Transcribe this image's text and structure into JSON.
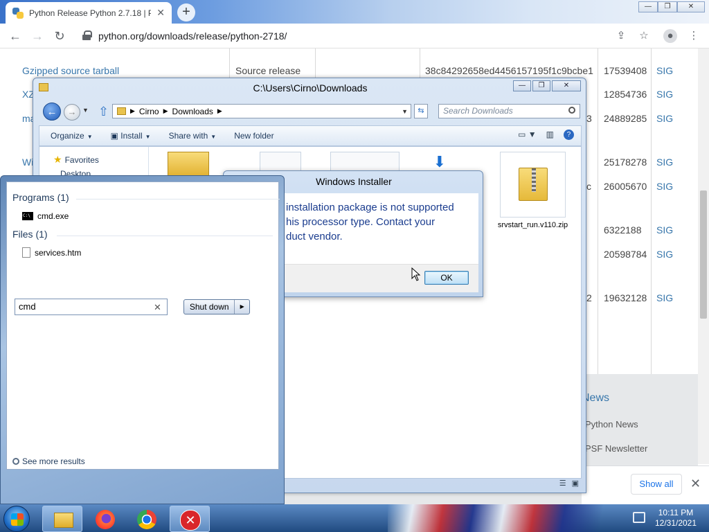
{
  "browser": {
    "tab_title": "Python Release Python 2.7.18 | P",
    "tab_close": "✕",
    "new_tab": "+",
    "url": "python.org/downloads/release/python-2718/",
    "window_controls": [
      "—",
      "❐",
      "✕"
    ]
  },
  "downloads_table": {
    "rows": [
      {
        "name": "Gzipped source tarball",
        "os": "Source release",
        "md5": "38c84292658ed4456157195f1c9bcbe1",
        "size": "17539408",
        "sig": "SIG"
      },
      {
        "name": "XZ",
        "size": "12854736",
        "sig": "SIG"
      },
      {
        "name": "ma",
        "md5_tail": "3",
        "size": "24889285",
        "sig": "SIG"
      },
      {
        "name": "Wi",
        "size": "25178278",
        "sig": "SIG"
      },
      {
        "md5_tail": "c",
        "size": "26005670",
        "sig": "SIG"
      },
      {
        "size": "6322188",
        "sig": "SIG"
      },
      {
        "size": "20598784",
        "sig": "SIG"
      },
      {
        "md5_tail": "2",
        "size": "19632128",
        "sig": "SIG"
      }
    ],
    "news_heading": "News",
    "news_items": [
      "Python News",
      "PSF Newsletter"
    ]
  },
  "download_bar": {
    "show_all": "Show all",
    "close": "✕"
  },
  "explorer": {
    "title": "C:\\Users\\Cirno\\Downloads",
    "breadcrumb": [
      "Cirno",
      "Downloads"
    ],
    "search_placeholder": "Search Downloads",
    "commands": [
      "Organize",
      "Install",
      "Share with",
      "New folder"
    ],
    "nav": {
      "favorites": "Favorites",
      "desktop": "Desktop"
    },
    "file": {
      "name": "srvstart_run.v110.zip"
    },
    "window_controls": [
      "—",
      "❐",
      "✕"
    ]
  },
  "installer": {
    "title": "Windows Installer",
    "message": "installation package is not supported\nhis processor type. Contact your\nduct vendor.",
    "ok_label": "OK"
  },
  "start_menu": {
    "programs_heading": "Programs (1)",
    "programs": [
      "cmd.exe"
    ],
    "files_heading": "Files (1)",
    "files": [
      "services.htm"
    ],
    "see_more": "See more results",
    "search_value": "cmd",
    "search_clear": "✕",
    "shutdown_label": "Shut down"
  },
  "taskbar": {
    "time": "10:11 PM",
    "date": "12/31/2021"
  }
}
